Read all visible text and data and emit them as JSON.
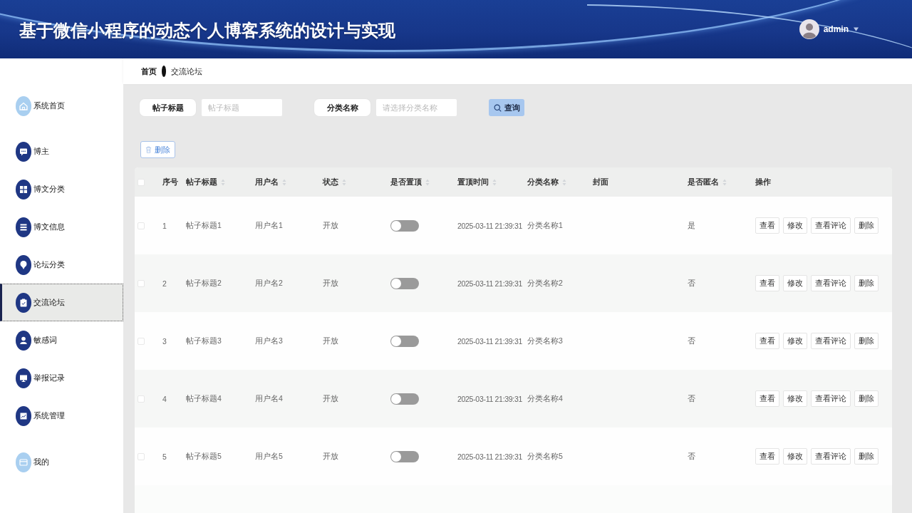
{
  "header": {
    "title": "基于微信小程序的动态个人博客系统的设计与实现",
    "user": "admin"
  },
  "breadcrumb": [
    {
      "label": "首页"
    },
    {
      "label": "交流论坛"
    }
  ],
  "sidebar": {
    "items": [
      {
        "label": "系统首页",
        "kind": "link",
        "selected": false
      },
      {
        "label": "博主",
        "kind": "menu",
        "selected": false
      },
      {
        "label": "博文分类",
        "kind": "menu",
        "selected": false
      },
      {
        "label": "博文信息",
        "kind": "menu",
        "selected": false
      },
      {
        "label": "论坛分类",
        "kind": "menu",
        "selected": false
      },
      {
        "label": "交流论坛",
        "kind": "menu",
        "selected": true
      },
      {
        "label": "敏感词",
        "kind": "menu",
        "selected": false
      },
      {
        "label": "举报记录",
        "kind": "menu",
        "selected": false
      },
      {
        "label": "系统管理",
        "kind": "menu",
        "selected": false
      },
      {
        "label": "我的",
        "kind": "link",
        "selected": false
      }
    ]
  },
  "search": {
    "fields": [
      {
        "label": "帖子标题",
        "placeholder": "帖子标题"
      },
      {
        "label": "分类名称",
        "placeholder": "请选择分类名称"
      }
    ],
    "button": "查询"
  },
  "toolbar": {
    "delete_button": "删除"
  },
  "table": {
    "all_checked": false,
    "columns": [
      {
        "label": "序号",
        "sortable": false
      },
      {
        "label": "帖子标题",
        "sortable": true
      },
      {
        "label": "用户名",
        "sortable": true
      },
      {
        "label": "状态",
        "sortable": true
      },
      {
        "label": "是否置顶",
        "sortable": true
      },
      {
        "label": "置顶时间",
        "sortable": true
      },
      {
        "label": "分类名称",
        "sortable": true
      },
      {
        "label": "封面",
        "sortable": false
      },
      {
        "label": "是否匿名",
        "sortable": true
      },
      {
        "label": "操作",
        "sortable": false
      }
    ],
    "rows": [
      {
        "checked": false,
        "no": "1",
        "title": "帖子标题1",
        "user": "用户名1",
        "status": "开放",
        "pinned": false,
        "pinned_time": "2025-03-11 21:39:31",
        "category": "分类名称1",
        "anonymous": "是",
        "actions": [
          "查看",
          "修改",
          "查看评论",
          "删除"
        ]
      },
      {
        "checked": false,
        "no": "2",
        "title": "帖子标题2",
        "user": "用户名2",
        "status": "开放",
        "pinned": false,
        "pinned_time": "2025-03-11 21:39:31",
        "category": "分类名称2",
        "anonymous": "否",
        "actions": [
          "查看",
          "修改",
          "查看评论",
          "删除"
        ]
      },
      {
        "checked": false,
        "no": "3",
        "title": "帖子标题3",
        "user": "用户名3",
        "status": "开放",
        "pinned": false,
        "pinned_time": "2025-03-11 21:39:31",
        "category": "分类名称3",
        "anonymous": "否",
        "actions": [
          "查看",
          "修改",
          "查看评论",
          "删除"
        ]
      },
      {
        "checked": false,
        "no": "4",
        "title": "帖子标题4",
        "user": "用户名4",
        "status": "开放",
        "pinned": false,
        "pinned_time": "2025-03-11 21:39:31",
        "category": "分类名称4",
        "anonymous": "否",
        "actions": [
          "查看",
          "修改",
          "查看评论",
          "删除"
        ]
      },
      {
        "checked": false,
        "no": "5",
        "title": "帖子标题5",
        "user": "用户名5",
        "status": "开放",
        "pinned": false,
        "pinned_time": "2025-03-11 21:39:31",
        "category": "分类名称5",
        "anonymous": "否",
        "actions": [
          "查看",
          "修改",
          "查看评论",
          "删除"
        ]
      }
    ]
  }
}
